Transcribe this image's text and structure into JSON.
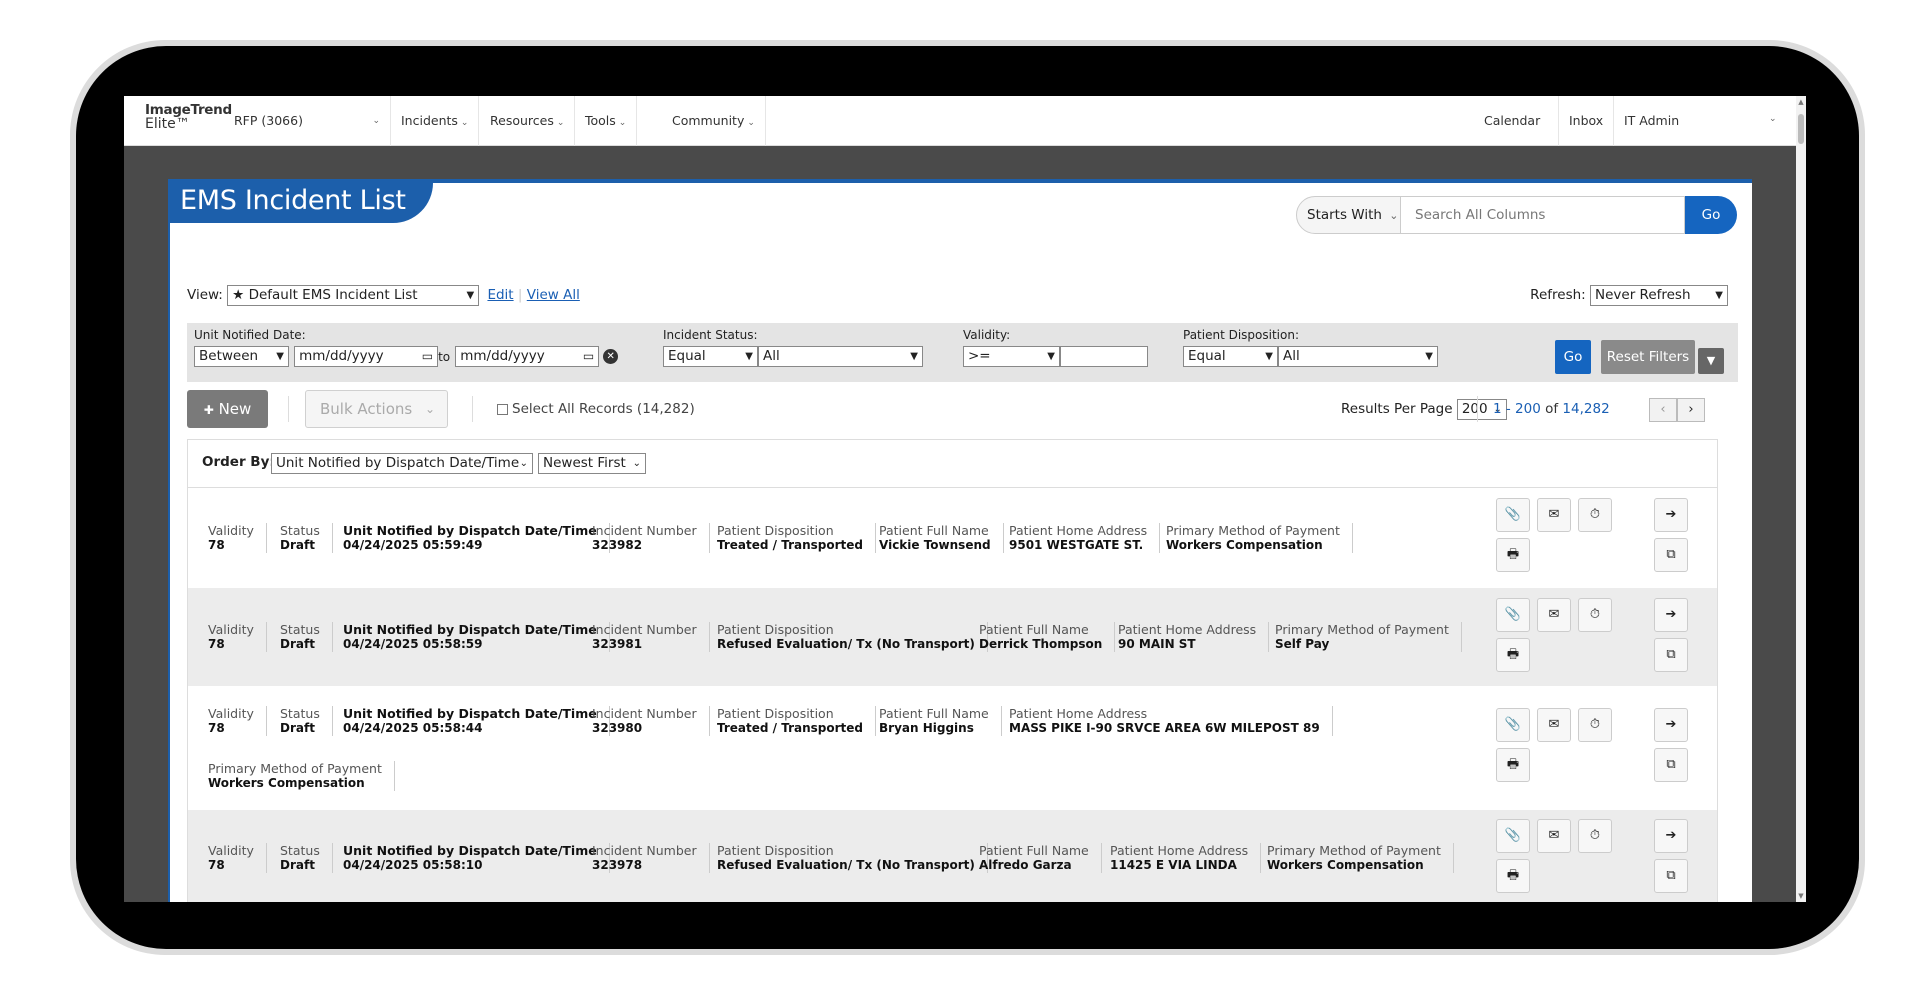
{
  "nav": {
    "logo_line1": "ImageTrend",
    "logo_line2": "Elite™",
    "agency": "RFP (3066)",
    "menu": [
      "Incidents",
      "Resources",
      "Tools",
      "Community"
    ],
    "calendar": "Calendar",
    "inbox": "Inbox",
    "user": "IT Admin"
  },
  "page": {
    "title": "EMS Incident List",
    "search_mode": "Starts With",
    "search_placeholder": "Search All Columns",
    "search_go": "Go"
  },
  "view": {
    "label": "View:",
    "selected": "Default EMS Incident List",
    "edit": "Edit",
    "view_all": "View All",
    "refresh_label": "Refresh:",
    "refresh_value": "Never Refresh"
  },
  "filters": {
    "unit_notified_label": "Unit Notified Date:",
    "unit_op": "Between",
    "date_from": "mm/dd/yyyy",
    "to": "to",
    "date_to": "mm/dd/yyyy",
    "status_label": "Incident Status:",
    "status_op": "Equal",
    "status_val": "All",
    "validity_label": "Validity:",
    "validity_op": ">=",
    "validity_val": "",
    "disposition_label": "Patient Disposition:",
    "disposition_op": "Equal",
    "disposition_val": "All",
    "go": "Go",
    "reset": "Reset Filters"
  },
  "actions": {
    "new": "New",
    "bulk": "Bulk Actions",
    "select_all": "Select All Records (14,282)",
    "rpp_label": "Results Per Page",
    "rpp_value": "200",
    "pager_range": "1 - 200",
    "pager_of": "of",
    "pager_total": "14,282"
  },
  "order": {
    "label": "Order By:",
    "field": "Unit Notified by Dispatch Date/Time",
    "direction": "Newest First"
  },
  "labels": {
    "validity": "Validity",
    "status": "Status",
    "unit_notified": "Unit Notified by Dispatch Date/Time",
    "incident_number": "Incident Number",
    "disposition": "Patient Disposition",
    "full_name": "Patient Full Name",
    "home_address": "Patient Home Address",
    "payment": "Primary Method of Payment"
  },
  "records": [
    {
      "validity": "78",
      "status": "Draft",
      "datetime": "04/24/2025 05:59:49",
      "incident": "323982",
      "disposition": "Treated / Transported",
      "name": "Vickie Townsend",
      "address": "9501 WESTGATE ST.",
      "payment": "Workers Compensation"
    },
    {
      "validity": "78",
      "status": "Draft",
      "datetime": "04/24/2025 05:58:59",
      "incident": "323981",
      "disposition": "Refused Evaluation/ Tx (No Transport)",
      "name": "Derrick Thompson",
      "address": "90 MAIN ST",
      "payment": "Self Pay"
    },
    {
      "validity": "78",
      "status": "Draft",
      "datetime": "04/24/2025 05:58:44",
      "incident": "323980",
      "disposition": "Treated / Transported",
      "name": "Bryan Higgins",
      "address": "MASS PIKE I-90 SRVCE AREA 6W MILEPOST 89",
      "payment": "Workers Compensation"
    },
    {
      "validity": "78",
      "status": "Draft",
      "datetime": "04/24/2025 05:58:10",
      "incident": "323978",
      "disposition": "Refused Evaluation/ Tx (No Transport)",
      "name": "Alfredo Garza",
      "address": "11425 E VIA LINDA",
      "payment": "Workers Compensation"
    }
  ],
  "icons": {
    "attach": "📎",
    "mail": "✉",
    "clock": "⏱",
    "print": "🖶",
    "arrow": "➔",
    "external": "⧉",
    "plus": "✚",
    "star": "★"
  }
}
